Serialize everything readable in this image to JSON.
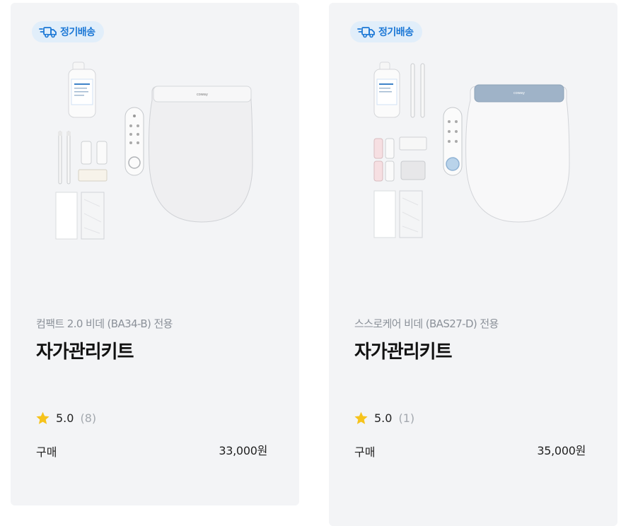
{
  "products": [
    {
      "badge": "정기배송",
      "subtitle": "컴팩트 2.0 비데 (BA34-B) 전용",
      "title": "자가관리키트",
      "rating": "5.0",
      "review_count": "(8)",
      "buy_label": "구매",
      "price": "33,000원",
      "brand_mark": "coway"
    },
    {
      "badge": "정기배송",
      "subtitle": "스스로케어 비데 (BAS27-D) 전용",
      "title": "자가관리키트",
      "rating": "5.0",
      "review_count": "(1)",
      "buy_label": "구매",
      "price": "35,000원",
      "brand_mark": "coway"
    }
  ],
  "icons": {
    "badge_icon": "delivery-truck-icon",
    "rating_icon": "star-icon"
  },
  "colors": {
    "card_bg": "#f3f4f6",
    "badge_bg": "#e1eefa",
    "badge_text": "#1c78d6",
    "star": "#f6c31c",
    "subtitle": "#8b9199",
    "title": "#111111",
    "count": "#a3a8ae"
  }
}
